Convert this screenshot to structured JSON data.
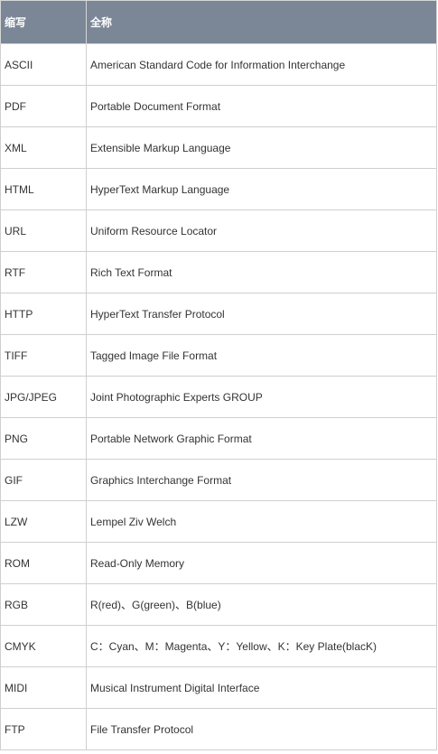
{
  "table": {
    "headers": [
      "缩写",
      "全称"
    ],
    "rows": [
      [
        "ASCII",
        "American Standard Code for Information Interchange"
      ],
      [
        "PDF",
        "Portable Document Format"
      ],
      [
        "XML",
        "Extensible Markup Language"
      ],
      [
        "HTML",
        "HyperText Markup Language"
      ],
      [
        "URL",
        "Uniform Resource Locator"
      ],
      [
        "RTF",
        "Rich Text Format"
      ],
      [
        "HTTP",
        "HyperText Transfer Protocol"
      ],
      [
        "TIFF",
        "Tagged Image File Format"
      ],
      [
        "JPG/JPEG",
        "Joint Photographic Experts GROUP"
      ],
      [
        "PNG",
        "Portable Network Graphic Format"
      ],
      [
        "GIF",
        "Graphics Interchange Format"
      ],
      [
        "LZW",
        "Lempel Ziv Welch"
      ],
      [
        "ROM",
        "Read-Only Memory"
      ],
      [
        "RGB",
        "R(red)、G(green)、B(blue)"
      ],
      [
        "CMYK",
        "C：Cyan、M：Magenta、Y：Yellow、K：Key Plate(blacK)"
      ],
      [
        "MIDI",
        "Musical Instrument Digital Interface"
      ],
      [
        "FTP",
        "File Transfer Protocol"
      ]
    ]
  },
  "colors": {
    "header_bg": "#7b8796",
    "border": "#cfcfcf",
    "text": "#333333"
  }
}
